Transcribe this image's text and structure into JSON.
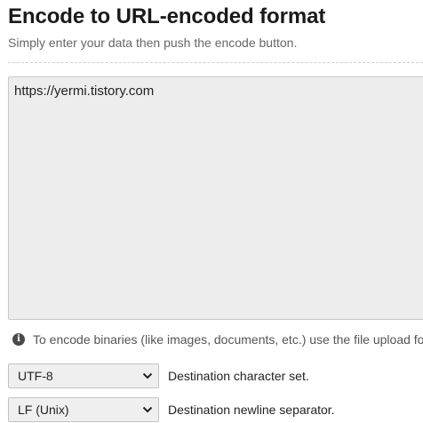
{
  "header": {
    "title": "Encode to URL-encoded format",
    "subtitle": "Simply enter your data then push the encode button."
  },
  "input": {
    "value": "https://yermi.tistory.com"
  },
  "info": {
    "icon": "info-icon",
    "glyph": "i",
    "text": "To encode binaries (like images, documents, etc.) use the file upload form a little further down on this page."
  },
  "options": {
    "charset": {
      "selected": "UTF-8",
      "label": "Destination character set."
    },
    "newline": {
      "selected": "LF (Unix)",
      "label": "Destination newline separator."
    }
  }
}
